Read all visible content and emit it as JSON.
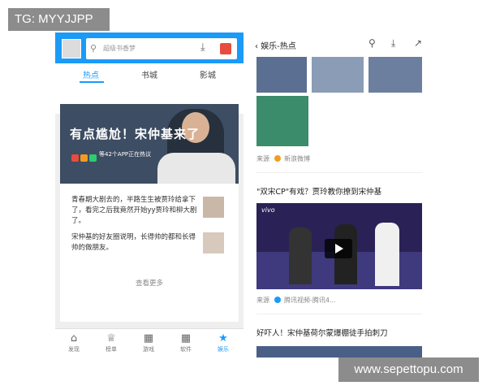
{
  "watermarks": {
    "top_left": "TG: MYYJJPP",
    "bottom_right": "www.sepettopu.com"
  },
  "left_app": {
    "search_placeholder": "超级书香梦",
    "tabs": [
      {
        "label": "热点",
        "active": true
      },
      {
        "label": "书城",
        "active": false
      },
      {
        "label": "影城",
        "active": false
      }
    ],
    "hero": {
      "title": "有点尴尬！宋仲基来了",
      "subtitle": "等42个APP正在热议"
    },
    "items": [
      {
        "text": "青春期大剧去的，半路生生被贾玲给拿下了，看完之后我竟然开始yy贾玲和柳大剧了。"
      },
      {
        "text": "宋仲基的好友圈说明，长得帅的都和长得帅的做朋友。"
      }
    ],
    "more_label": "查看更多",
    "bottom_nav": [
      {
        "icon": "home-icon",
        "label": "发现",
        "active": false
      },
      {
        "label": "榜单",
        "active": false
      },
      {
        "label": "游戏",
        "active": false
      },
      {
        "label": "软件",
        "active": false
      },
      {
        "label": "娱乐",
        "active": true
      }
    ]
  },
  "right_app": {
    "header_title": "娱乐-热点",
    "source1": {
      "prefix": "来源",
      "name": "新浪微博"
    },
    "article2_title": "\"双宋CP\"有戏？贾玲教你撩到宋仲基",
    "video_logo": "vivo",
    "source2": {
      "prefix": "来源",
      "name": "腾讯视频-腾讯4..."
    },
    "article3_title": "好吓人！宋仲基荷尔蒙爆棚徒手拍刺刀"
  },
  "colors": {
    "accent": "#1b9af7",
    "background": "#efefef"
  }
}
